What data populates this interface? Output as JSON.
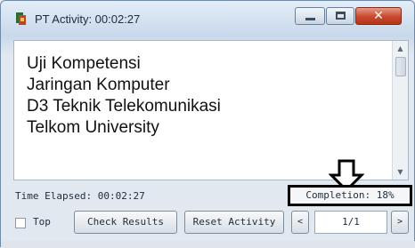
{
  "window": {
    "title": "PT Activity: 00:02:27"
  },
  "content": {
    "lines": [
      "Uji Kompetensi",
      "Jaringan Komputer",
      "D3 Teknik Telekomunikasi",
      "Telkom University"
    ]
  },
  "footer": {
    "time_elapsed": "Time Elapsed: 00:02:27",
    "completion": "Completion: 18%",
    "top_label": "Top",
    "top_checked": false,
    "check_results_label": "Check Results",
    "reset_activity_label": "Reset Activity",
    "prev_label": "<",
    "next_label": ">",
    "page_indicator": "1/1"
  },
  "icons": {
    "app": "packet-tracer-icon",
    "minimize": "minimize-icon",
    "maximize": "maximize-icon",
    "close": "close-icon",
    "annotation": "down-arrow-icon"
  },
  "colors": {
    "close_button": "#c8472d",
    "title_bar": "#d9e6f3"
  }
}
